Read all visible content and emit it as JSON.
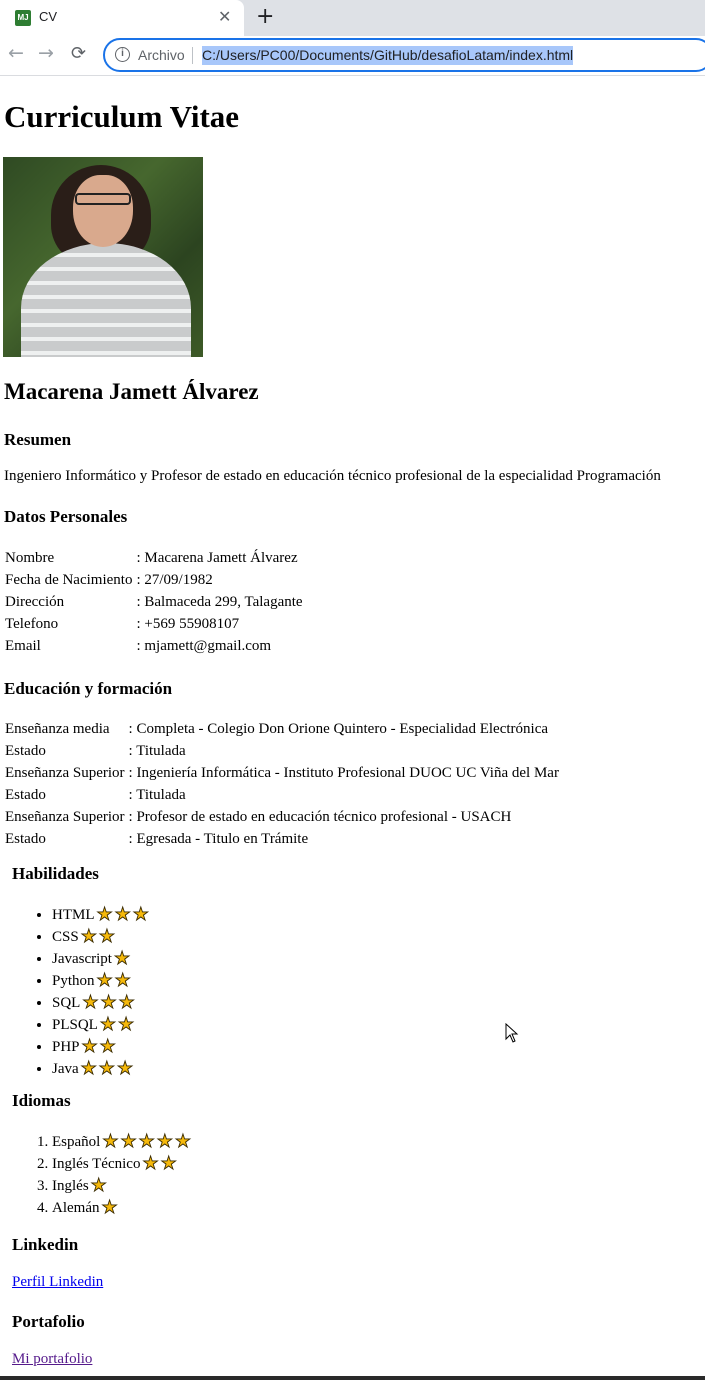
{
  "browser": {
    "tab_title": "CV",
    "favicon_text": "MJ",
    "new_tab_symbol": "+",
    "security_label": "Archivo",
    "url": "C:/Users/PC00/Documents/GitHub/desafioLatam/index.html"
  },
  "page": {
    "title": "Curriculum Vitae",
    "name": "Macarena Jamett Álvarez",
    "resumen": {
      "heading": "Resumen",
      "text": "Ingeniero Informático y Profesor de estado en educación técnico profesional de la especialidad Programación"
    },
    "datos_personales": {
      "heading": "Datos Personales",
      "rows": [
        {
          "label": "Nombre",
          "value": ": Macarena Jamett Álvarez"
        },
        {
          "label": "Fecha de Nacimiento",
          "value": ": 27/09/1982"
        },
        {
          "label": "Dirección",
          "value": ": Balmaceda 299, Talagante"
        },
        {
          "label": "Telefono",
          "value": ": +569 55908107"
        },
        {
          "label": "Email",
          "value": ": mjamett@gmail.com"
        }
      ]
    },
    "educacion": {
      "heading": "Educación y formación",
      "rows": [
        {
          "label": "Enseñanza media",
          "value": ": Completa - Colegio Don Orione Quintero - Especialidad Electrónica"
        },
        {
          "label": "Estado",
          "value": ": Titulada"
        },
        {
          "label": "Enseñanza Superior",
          "value": ": Ingeniería Informática - Instituto Profesional DUOC UC Viña del Mar"
        },
        {
          "label": "Estado",
          "value": ": Titulada"
        },
        {
          "label": "Enseñanza Superior",
          "value": ": Profesor de estado en educación técnico profesional - USACH"
        },
        {
          "label": "Estado",
          "value": ": Egresada - Titulo en Trámite"
        }
      ]
    },
    "habilidades": {
      "heading": "Habilidades",
      "items": [
        {
          "label": "HTML",
          "stars": 3
        },
        {
          "label": "CSS",
          "stars": 2
        },
        {
          "label": "Javascript",
          "stars": 1
        },
        {
          "label": "Python",
          "stars": 2
        },
        {
          "label": "SQL",
          "stars": 3
        },
        {
          "label": "PLSQL",
          "stars": 2
        },
        {
          "label": "PHP",
          "stars": 2
        },
        {
          "label": "Java",
          "stars": 3
        }
      ]
    },
    "idiomas": {
      "heading": "Idiomas",
      "items": [
        {
          "label": "Español",
          "stars": 5
        },
        {
          "label": "Inglés Técnico",
          "stars": 2
        },
        {
          "label": "Inglés",
          "stars": 1
        },
        {
          "label": "Alemán",
          "stars": 1
        }
      ]
    },
    "linkedin": {
      "heading": "Linkedin",
      "link_text": "Perfil Linkedin"
    },
    "portafolio": {
      "heading": "Portafolio",
      "link_text": "Mi portafolio"
    },
    "star_icon": "star-icon",
    "colors": {
      "star": "#f6b90b",
      "link": "#0000ee",
      "visited_link": "#551a8b",
      "url_highlight": "#a8c7fa"
    }
  }
}
